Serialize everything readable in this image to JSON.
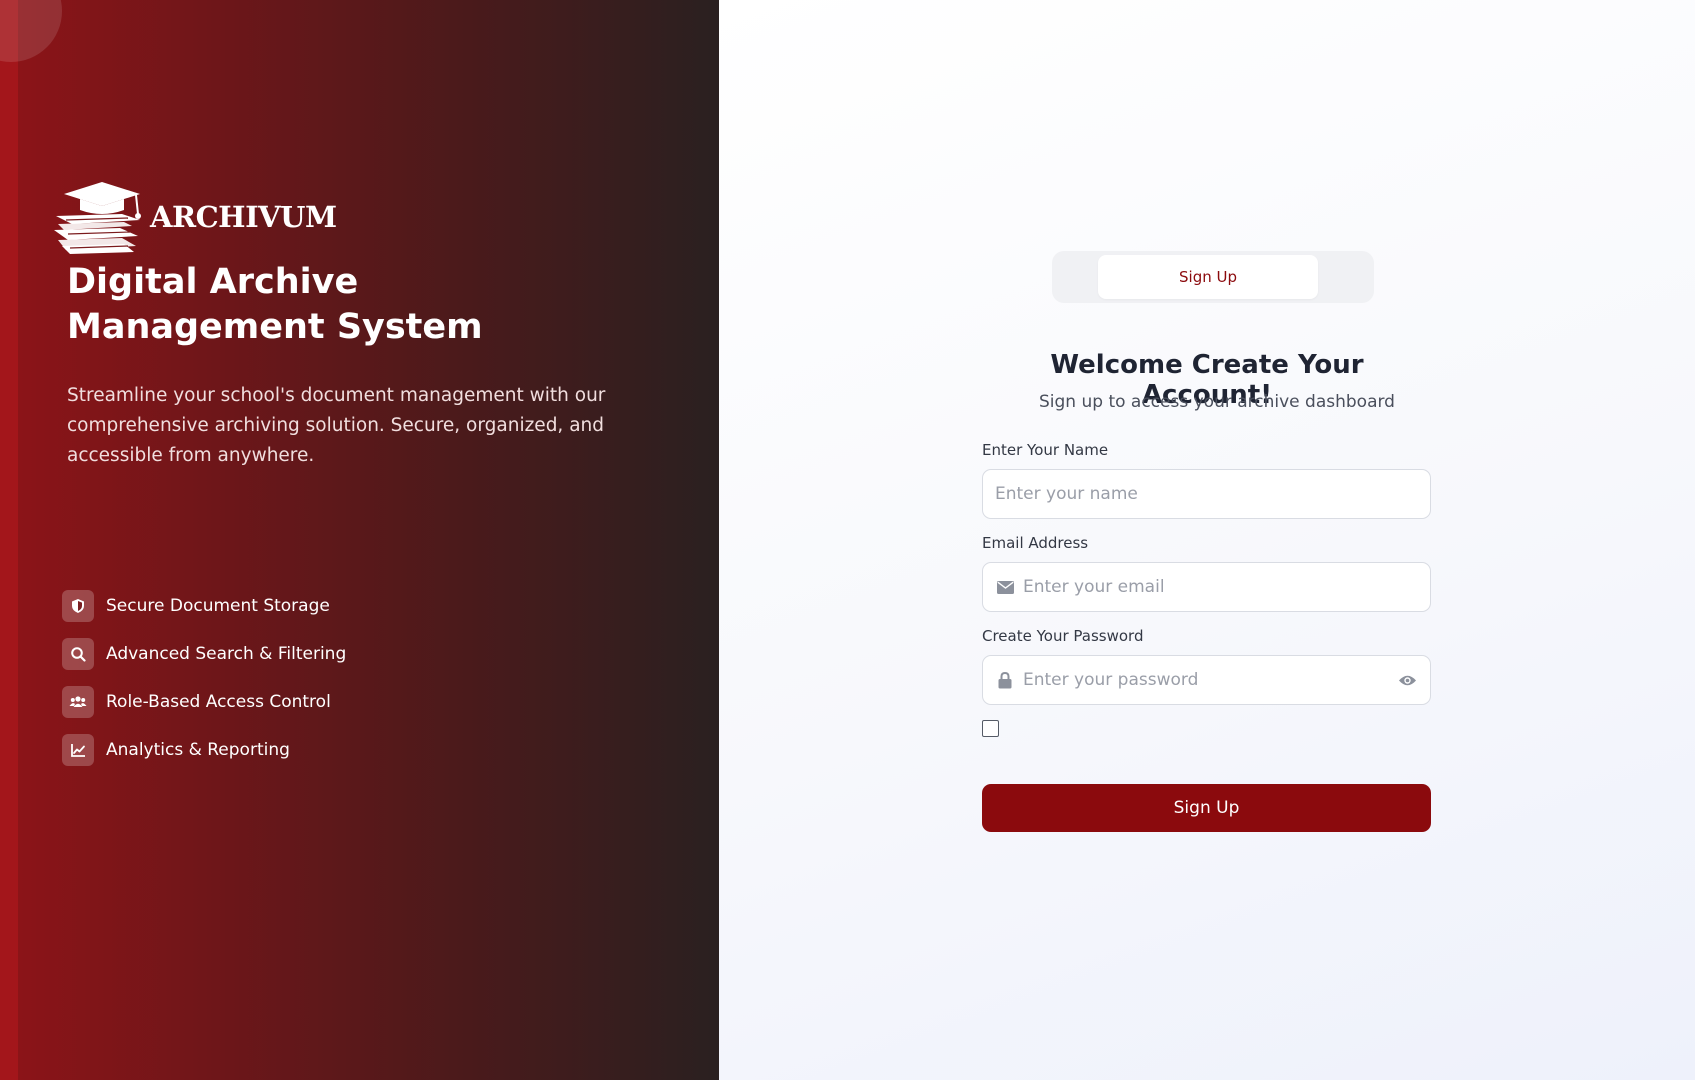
{
  "brand": {
    "name": "ARCHIVUM",
    "headline": [
      "Digital Archive",
      "Management System"
    ],
    "description": "Streamline your school's document management with our comprehensive archiving solution. Secure, organized, and accessible from anywhere."
  },
  "features": [
    {
      "icon": "shield-icon",
      "label": "Secure Document Storage"
    },
    {
      "icon": "search-icon",
      "label": "Advanced Search & Filtering"
    },
    {
      "icon": "users-icon",
      "label": "Role-Based Access Control"
    },
    {
      "icon": "chart-line-icon",
      "label": "Analytics & Reporting"
    }
  ],
  "tabs": {
    "active": "Sign Up"
  },
  "form": {
    "title": "Welcome Create Your Account!",
    "subtitle": "Sign up to access your archive dashboard",
    "name": {
      "label": "Enter Your Name",
      "placeholder": "Enter your name",
      "value": ""
    },
    "email": {
      "label": "Email Address",
      "placeholder": "Enter your email",
      "value": "",
      "icon": "envelope-icon"
    },
    "password": {
      "label": "Create Your Password",
      "placeholder": "Enter your password",
      "value": "",
      "icon": "lock-icon",
      "toggle_icon": "eye-icon"
    },
    "checkbox_checked": false,
    "submit_label": "Sign Up"
  },
  "colors": {
    "brand_red": "#8b0a0d",
    "panel_dark": "#2a2020",
    "edge_red": "#a3161b"
  }
}
